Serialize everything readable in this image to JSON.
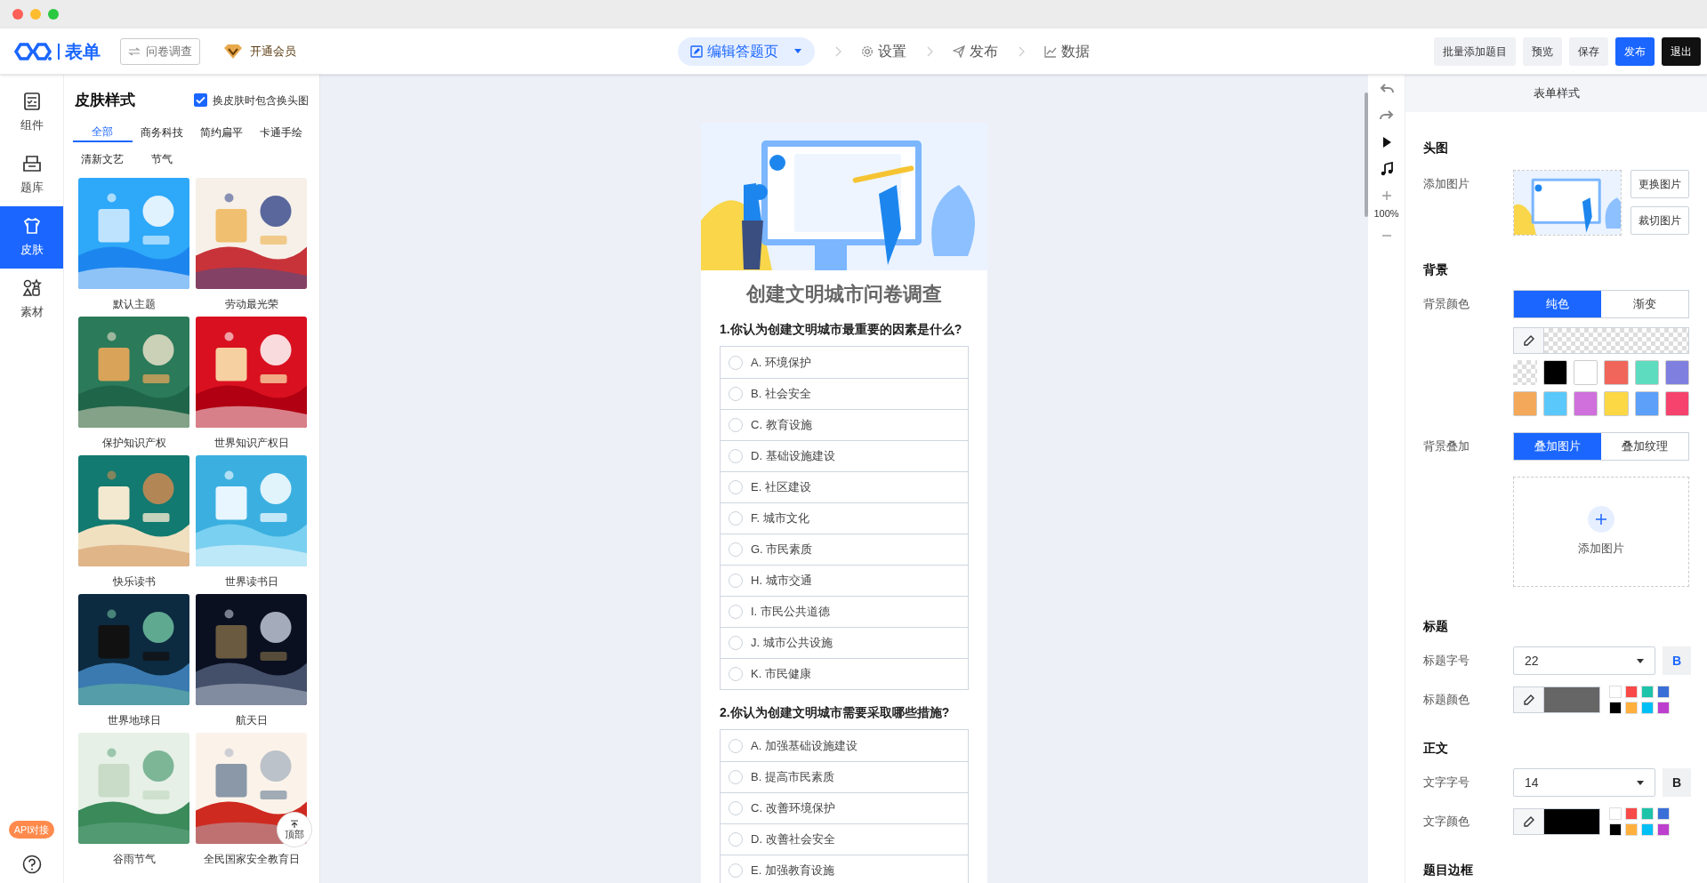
{
  "topbar": {
    "logo_text": "表单",
    "type_button": "问卷调查",
    "vip": "开通会员",
    "steps": [
      {
        "label": "编辑答题页",
        "selected": true
      },
      {
        "label": "设置",
        "selected": false
      },
      {
        "label": "发布",
        "selected": false
      },
      {
        "label": "数据",
        "selected": false
      }
    ],
    "actions": [
      {
        "label": "批量添加题目",
        "kind": "secondary"
      },
      {
        "label": "预览",
        "kind": "secondary"
      },
      {
        "label": "保存",
        "kind": "secondary"
      },
      {
        "label": "发布",
        "kind": "primary"
      },
      {
        "label": "退出",
        "kind": "dark"
      }
    ]
  },
  "rail": {
    "items": [
      {
        "label": "组件",
        "selected": false
      },
      {
        "label": "题库",
        "selected": false
      },
      {
        "label": "皮肤",
        "selected": true
      },
      {
        "label": "素材",
        "selected": false
      }
    ],
    "api_badge": "API对接"
  },
  "skin_panel": {
    "title": "皮肤样式",
    "include_header": {
      "label": "换皮肤时包含换头图",
      "checked": true
    },
    "categories": [
      {
        "label": "全部",
        "selected": true
      },
      {
        "label": "商务科技",
        "selected": false
      },
      {
        "label": "简约扁平",
        "selected": false
      },
      {
        "label": "卡通手绘",
        "selected": false
      },
      {
        "label": "清新文艺",
        "selected": false
      },
      {
        "label": "节气",
        "selected": false
      }
    ],
    "themes": [
      {
        "name": "默认主题"
      },
      {
        "name": "劳动最光荣"
      },
      {
        "name": "保护知识产权"
      },
      {
        "name": "世界知识产权日"
      },
      {
        "name": "快乐读书"
      },
      {
        "name": "世界读书日"
      },
      {
        "name": "世界地球日"
      },
      {
        "name": "航天日"
      },
      {
        "name": "谷雨节气"
      },
      {
        "name": "全民国家安全教育日"
      }
    ],
    "to_top": "顶部"
  },
  "form": {
    "title": "创建文明城市问卷调查",
    "questions": [
      {
        "title": "1.你认为创建文明城市最重要的因素是什么?",
        "options": [
          {
            "label": "A. 环境保护",
            "selected": false
          },
          {
            "label": "B. 社会安全",
            "selected": false
          },
          {
            "label": "C. 教育设施",
            "selected": false
          },
          {
            "label": "D. 基础设施建设",
            "selected": false
          },
          {
            "label": "E. 社区建设",
            "selected": false
          },
          {
            "label": "F. 城市文化",
            "selected": false
          },
          {
            "label": "G. 市民素质",
            "selected": false
          },
          {
            "label": "H. 城市交通",
            "selected": false
          },
          {
            "label": "I. 市民公共道德",
            "selected": false
          },
          {
            "label": "J. 城市公共设施",
            "selected": false
          },
          {
            "label": "K. 市民健康",
            "selected": false
          }
        ]
      },
      {
        "title": "2.你认为创建文明城市需要采取哪些措施?",
        "options": [
          {
            "label": "A. 加强基础设施建设",
            "selected": false
          },
          {
            "label": "B. 提高市民素质",
            "selected": false
          },
          {
            "label": "C. 改善环境保护",
            "selected": false
          },
          {
            "label": "D. 改善社会安全",
            "selected": false
          },
          {
            "label": "E. 加强教育设施",
            "selected": false
          }
        ]
      }
    ]
  },
  "toolbar": {
    "zoom": "100%"
  },
  "style_panel": {
    "header": "表单样式",
    "head_image": {
      "heading": "头图",
      "label": "添加图片",
      "buttons": [
        "更换图片",
        "裁切图片"
      ]
    },
    "background": {
      "heading": "背景",
      "color_label": "背景颜色",
      "color_modes": [
        {
          "label": "纯色",
          "selected": true
        },
        {
          "label": "渐变",
          "selected": false
        }
      ],
      "swatches": [
        {
          "kind": "transparent"
        },
        {
          "color": "#000000"
        },
        {
          "color": "#ffffff"
        },
        {
          "color": "#f0665a"
        },
        {
          "color": "#5ddcbf"
        },
        {
          "color": "#7f7fe0"
        },
        {
          "color": "#f4a85a"
        },
        {
          "color": "#5ac8fa"
        },
        {
          "color": "#d070dc"
        },
        {
          "color": "#fdd845"
        },
        {
          "color": "#5ca0fa"
        },
        {
          "color": "#f5436d"
        }
      ],
      "overlay_label": "背景叠加",
      "overlay_modes": [
        {
          "label": "叠加图片",
          "selected": true
        },
        {
          "label": "叠加纹理",
          "selected": false
        }
      ],
      "dropzone": "添加图片"
    },
    "text_groups": [
      {
        "heading": "标题",
        "size_label": "标题字号",
        "size": "22",
        "bold_label": "B",
        "bold": true,
        "color_label": "标题颜色",
        "color": "#666666",
        "palette": [
          {
            "color": "#ffffff"
          },
          {
            "color": "#f94949"
          },
          {
            "color": "#1dc4aa"
          },
          {
            "color": "#3a6fd8"
          },
          {
            "color": "#000000"
          },
          {
            "color": "#ffaf3c"
          },
          {
            "color": "#00bff5"
          },
          {
            "color": "#bd3fce"
          }
        ]
      },
      {
        "heading": "正文",
        "size_label": "文字字号",
        "size": "14",
        "bold_label": "B",
        "bold": false,
        "color_label": "文字颜色",
        "color": "#000000",
        "palette": [
          {
            "color": "#ffffff"
          },
          {
            "color": "#f94949"
          },
          {
            "color": "#1dc4aa"
          },
          {
            "color": "#3a6fd8"
          },
          {
            "color": "#000000"
          },
          {
            "color": "#ffaf3c"
          },
          {
            "color": "#00bff5"
          },
          {
            "color": "#bd3fce"
          }
        ]
      }
    ],
    "next_heading": "题目边框"
  }
}
